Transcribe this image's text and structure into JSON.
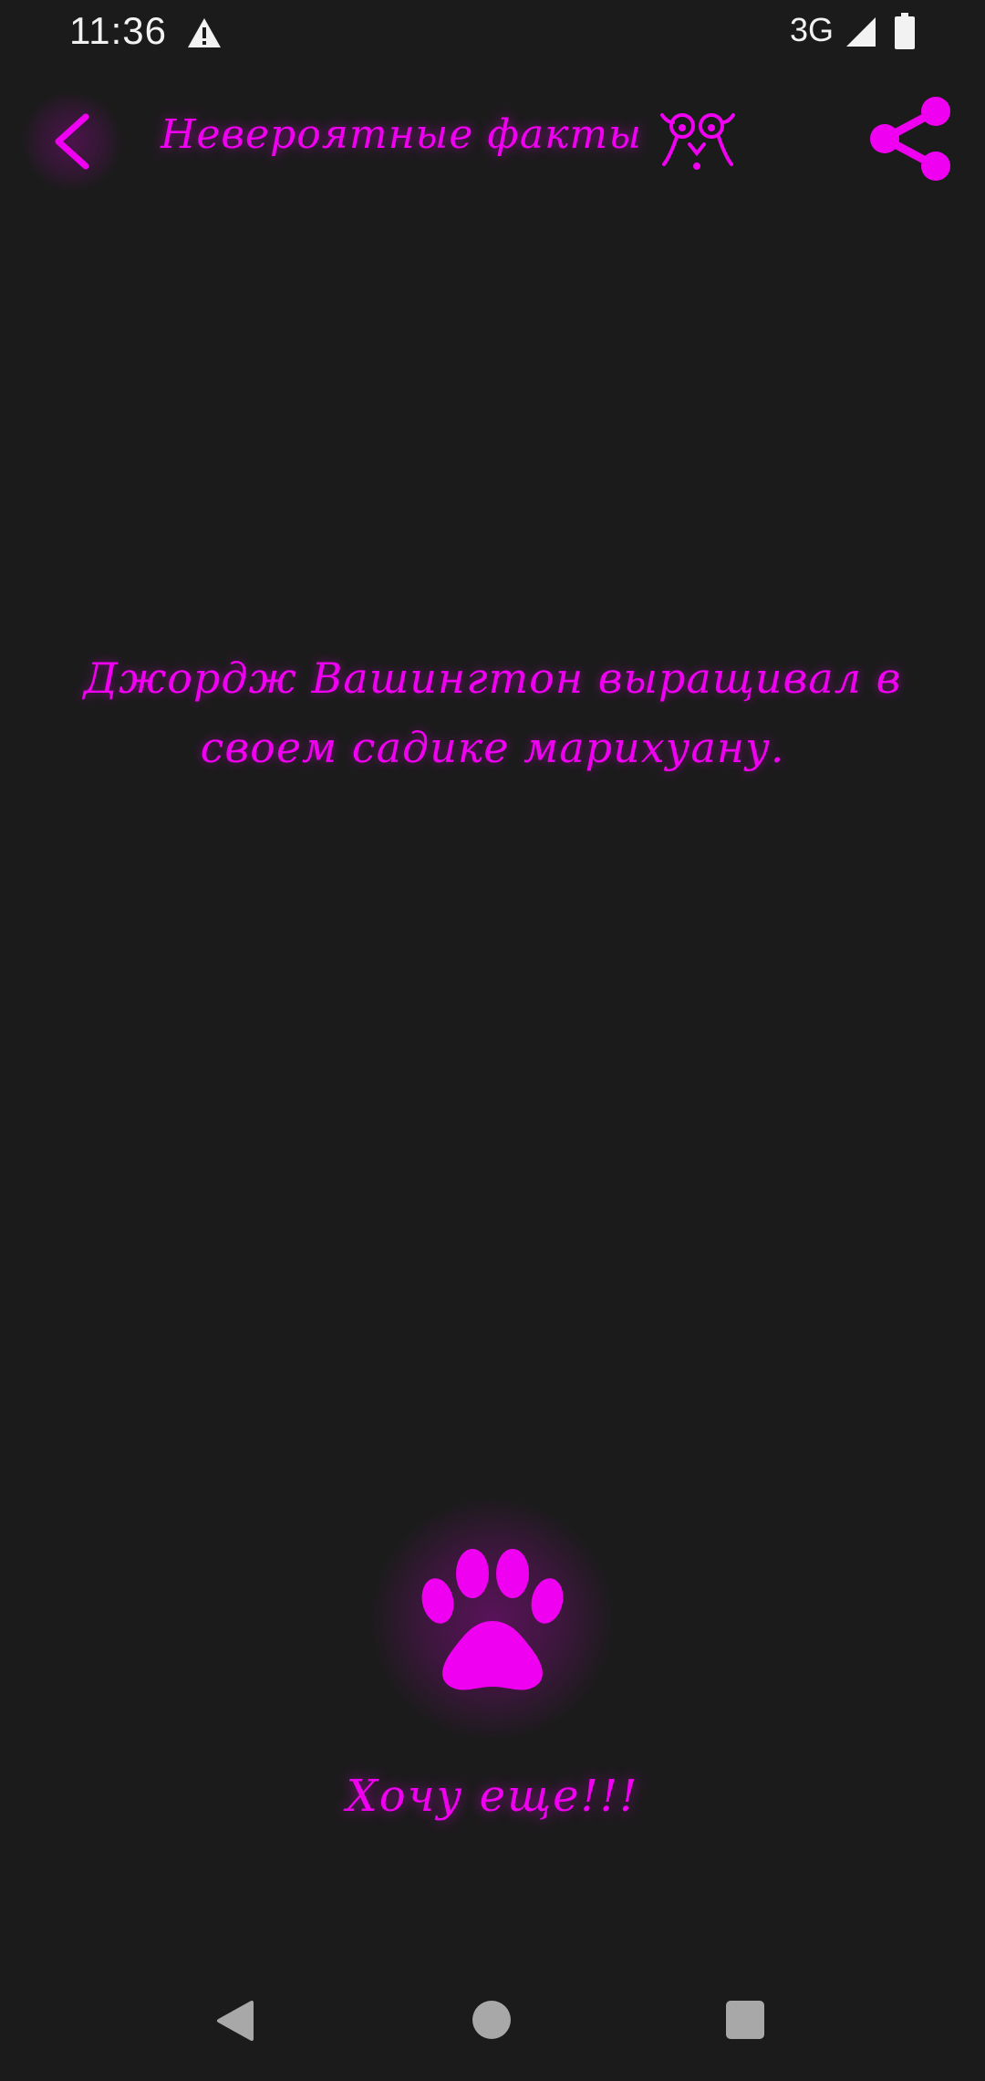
{
  "status_bar": {
    "time": "11:36",
    "network_type": "3G",
    "warning_icon": "warning-triangle-icon",
    "signal_icon": "cell-signal-icon",
    "battery_icon": "battery-icon"
  },
  "toolbar": {
    "title": "Невероятные факты",
    "back_icon": "chevron-left-icon",
    "title_emoji_icon": "wide-eyed-face-emoji-icon",
    "share_icon": "share-icon"
  },
  "fact": {
    "line1": "Джордж Вашингтон выращивал в",
    "line2": "своем садике марихуану."
  },
  "more_button": {
    "icon": "paw-icon",
    "label": "Хочу еще!!!"
  },
  "nav_bar": {
    "back_icon": "nav-back-triangle-icon",
    "home_icon": "nav-home-circle-icon",
    "recents_icon": "nav-recents-square-icon"
  },
  "colors": {
    "accent": "#f000f0",
    "background": "#1c1b1c",
    "status_text": "#f2f2f2",
    "nav_icons": "#a8a8a8"
  }
}
